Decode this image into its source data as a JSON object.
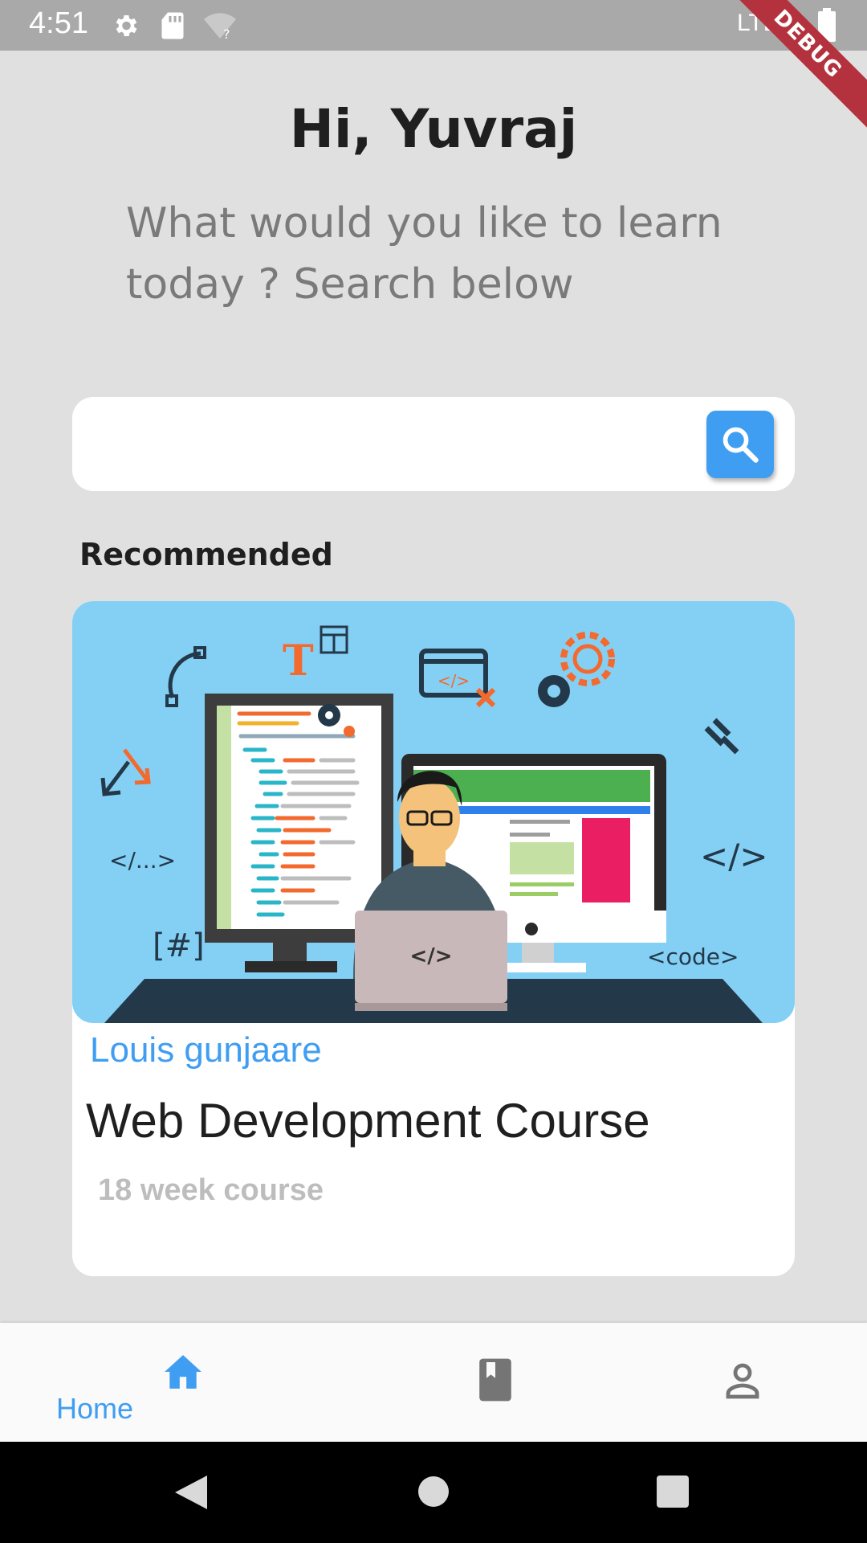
{
  "status_bar": {
    "time": "4:51",
    "network": "LTE",
    "debug_label": "DEBUG"
  },
  "header": {
    "greeting": "Hi, Yuvraj",
    "subtitle": "What would you like to learn today ? Search below"
  },
  "search": {
    "placeholder": "",
    "value": ""
  },
  "section": {
    "title": "Recommended"
  },
  "course_card": {
    "instructor": "Louis gunjaare",
    "title": "Web Development Course",
    "duration": "18 week course",
    "illustration_labels": {
      "code_ellipsis": "</...>",
      "hash": "[#]",
      "close_tag": "</>",
      "code_tag": "<code>",
      "laptop_tag": "</>",
      "letter_t": "T"
    }
  },
  "bottom_nav": {
    "items": [
      {
        "label": "Home",
        "icon": "home-icon",
        "active": true
      },
      {
        "label": "",
        "icon": "book-icon",
        "active": false
      },
      {
        "label": "",
        "icon": "person-icon",
        "active": false
      }
    ]
  },
  "colors": {
    "accent": "#3f9ef2",
    "background": "#e0e0e0",
    "card_image_bg": "#84d0f5",
    "status_bar": "#a9a9a9",
    "debug_ribbon": "#b3323e"
  }
}
